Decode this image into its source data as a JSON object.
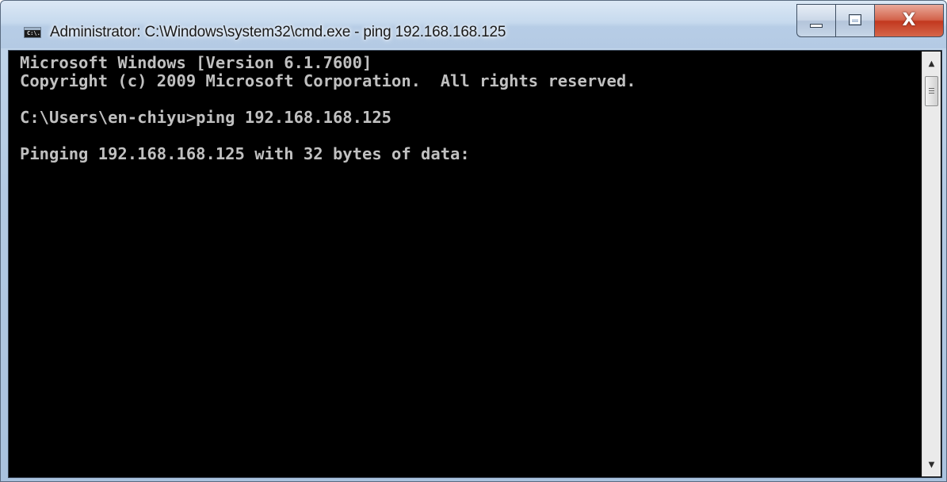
{
  "window": {
    "title": "Administrator: C:\\Windows\\system32\\cmd.exe - ping  192.168.168.125",
    "icon": "cmd-console-icon",
    "icon_glyph": "C:\\.",
    "caption": {
      "minimize_icon": "minimize-icon",
      "maximize_icon": "maximize-icon",
      "close_glyph": "X"
    }
  },
  "console": {
    "background": "#000000",
    "foreground": "#c0c0c0",
    "lines": [
      "Microsoft Windows [Version 6.1.7600]",
      "Copyright (c) 2009 Microsoft Corporation.  All rights reserved.",
      "",
      "C:\\Users\\en-chiyu>ping 192.168.168.125",
      "",
      "Pinging 192.168.168.125 with 32 bytes of data:"
    ]
  },
  "scrollbar": {
    "up_arrow": "▲",
    "down_arrow": "▼"
  },
  "colors": {
    "close_button": "#c7432a",
    "titlebar": "#c7daee"
  }
}
